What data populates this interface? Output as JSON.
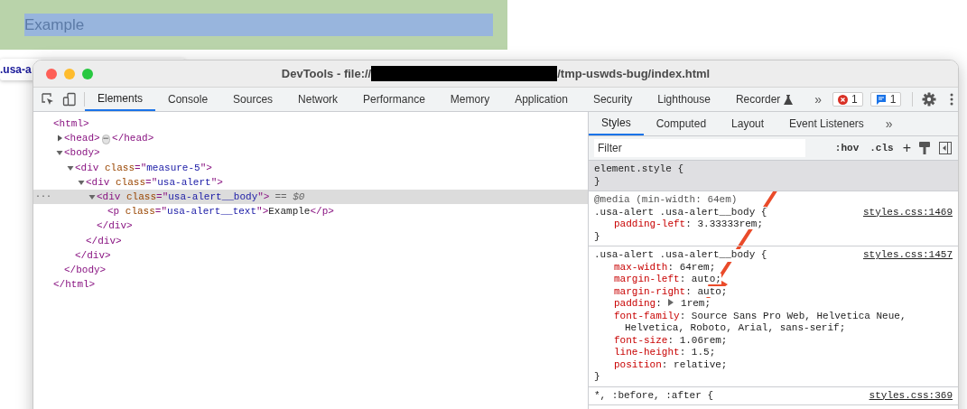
{
  "page": {
    "highlighted_text": "Example",
    "tooltip": ".usa-a"
  },
  "window": {
    "title_start": "DevTools - file://",
    "title_end": "/tmp-uswds-bug/index.html"
  },
  "tabs": [
    {
      "label": "Elements",
      "selected": true
    },
    {
      "label": "Console",
      "selected": false
    },
    {
      "label": "Sources",
      "selected": false
    },
    {
      "label": "Network",
      "selected": false
    },
    {
      "label": "Performance",
      "selected": false
    },
    {
      "label": "Memory",
      "selected": false
    },
    {
      "label": "Application",
      "selected": false
    },
    {
      "label": "Security",
      "selected": false
    },
    {
      "label": "Lighthouse",
      "selected": false
    },
    {
      "label": "Recorder",
      "selected": false,
      "experimental": true
    }
  ],
  "more_tabs": "»",
  "error_count": "1",
  "message_count": "1",
  "dom_tree": [
    {
      "selected": false,
      "open": [
        {
          "kind": "tag",
          "text": "<html>"
        }
      ],
      "children": [
        {
          "expanded": false,
          "selected": false,
          "open": [
            {
              "kind": "tag",
              "text": "<head>"
            }
          ],
          "collapsed_badge": "⋯",
          "close": [
            {
              "kind": "tag",
              "text": "</head>"
            }
          ]
        },
        {
          "expanded": true,
          "selected": false,
          "open": [
            {
              "kind": "tag",
              "text": "<body>"
            }
          ],
          "children": [
            {
              "expanded": true,
              "selected": false,
              "open": [
                {
                  "kind": "tag",
                  "text": "<div "
                },
                {
                  "kind": "attr",
                  "text": "class"
                },
                {
                  "kind": "tag",
                  "text": "=\""
                },
                {
                  "kind": "value",
                  "text": "measure-5"
                },
                {
                  "kind": "tag",
                  "text": "\">"
                }
              ],
              "children": [
                {
                  "expanded": true,
                  "selected": false,
                  "open": [
                    {
                      "kind": "tag",
                      "text": "<div "
                    },
                    {
                      "kind": "attr",
                      "text": "class"
                    },
                    {
                      "kind": "tag",
                      "text": "=\""
                    },
                    {
                      "kind": "value",
                      "text": "usa-alert"
                    },
                    {
                      "kind": "tag",
                      "text": "\">"
                    }
                  ],
                  "children": [
                    {
                      "expanded": true,
                      "selected": true,
                      "gutter": "···",
                      "suffix": "== $0",
                      "open": [
                        {
                          "kind": "tag",
                          "text": "<div "
                        },
                        {
                          "kind": "attr",
                          "text": "class"
                        },
                        {
                          "kind": "tag",
                          "text": "=\""
                        },
                        {
                          "kind": "value",
                          "text": "usa-alert__body"
                        },
                        {
                          "kind": "tag",
                          "text": "\">"
                        }
                      ],
                      "children": [
                        {
                          "selected": false,
                          "open": [
                            {
                              "kind": "tag",
                              "text": "<p "
                            },
                            {
                              "kind": "attr",
                              "text": "class"
                            },
                            {
                              "kind": "tag",
                              "text": "=\""
                            },
                            {
                              "kind": "value",
                              "text": "usa-alert__text"
                            },
                            {
                              "kind": "tag",
                              "text": "\">"
                            },
                            {
                              "kind": "text",
                              "text": "Example"
                            },
                            {
                              "kind": "tag",
                              "text": "</p>"
                            }
                          ]
                        }
                      ],
                      "close": [
                        {
                          "kind": "tag",
                          "text": "</div>"
                        }
                      ]
                    }
                  ],
                  "close": [
                    {
                      "kind": "tag",
                      "text": "</div>"
                    }
                  ]
                }
              ],
              "close": [
                {
                  "kind": "tag",
                  "text": "</div>"
                }
              ]
            }
          ],
          "close": [
            {
              "kind": "tag",
              "text": "</body>"
            }
          ]
        }
      ],
      "close": [
        {
          "kind": "tag",
          "text": "</html>"
        }
      ]
    }
  ],
  "sidebar_tabs": [
    {
      "label": "Styles",
      "selected": true
    },
    {
      "label": "Computed",
      "selected": false
    },
    {
      "label": "Layout",
      "selected": false
    },
    {
      "label": "Event Listeners",
      "selected": false
    }
  ],
  "sidebar_more": "»",
  "filter": {
    "placeholder": "Filter"
  },
  "hov": ":hov",
  "cls": ".cls",
  "add_rule": "+",
  "rules": [
    {
      "highlighted": true,
      "selector": "element.style {",
      "close": "}"
    },
    {
      "highlighted": false,
      "media": "@media (min-width: 64em)",
      "selector": ".usa-alert .usa-alert__body {",
      "source": "styles.css:1469",
      "close": "}",
      "declarations": [
        {
          "name": "padding-left",
          "sep": ":",
          "value": "3.33333rem;",
          "expandable": false
        }
      ]
    },
    {
      "highlighted": false,
      "selector": ".usa-alert .usa-alert__body {",
      "source": "styles.css:1457",
      "close": "}",
      "declarations": [
        {
          "name": "max-width",
          "sep": ":",
          "value": "64rem;",
          "expandable": false
        },
        {
          "name": "margin-left",
          "sep": ":",
          "value": "auto;",
          "expandable": false
        },
        {
          "name": "margin-right",
          "sep": ":",
          "value": "auto;",
          "expandable": false
        },
        {
          "name": "padding",
          "sep": ":",
          "value": "1rem;",
          "expandable": true
        },
        {
          "name": "font-family",
          "sep": ":",
          "value": "Source Sans Pro Web, Helvetica Neue, Helvetica, Roboto, Arial, sans-serif;",
          "expandable": false
        },
        {
          "name": "font-size",
          "sep": ":",
          "value": "1.06rem;",
          "expandable": false
        },
        {
          "name": "line-height",
          "sep": ":",
          "value": "1.5;",
          "expandable": false
        },
        {
          "name": "position",
          "sep": ":",
          "value": "relative;",
          "expandable": false
        }
      ]
    },
    {
      "highlighted": false,
      "selector": "*, :before, :after {",
      "source": "styles.css:369"
    }
  ]
}
